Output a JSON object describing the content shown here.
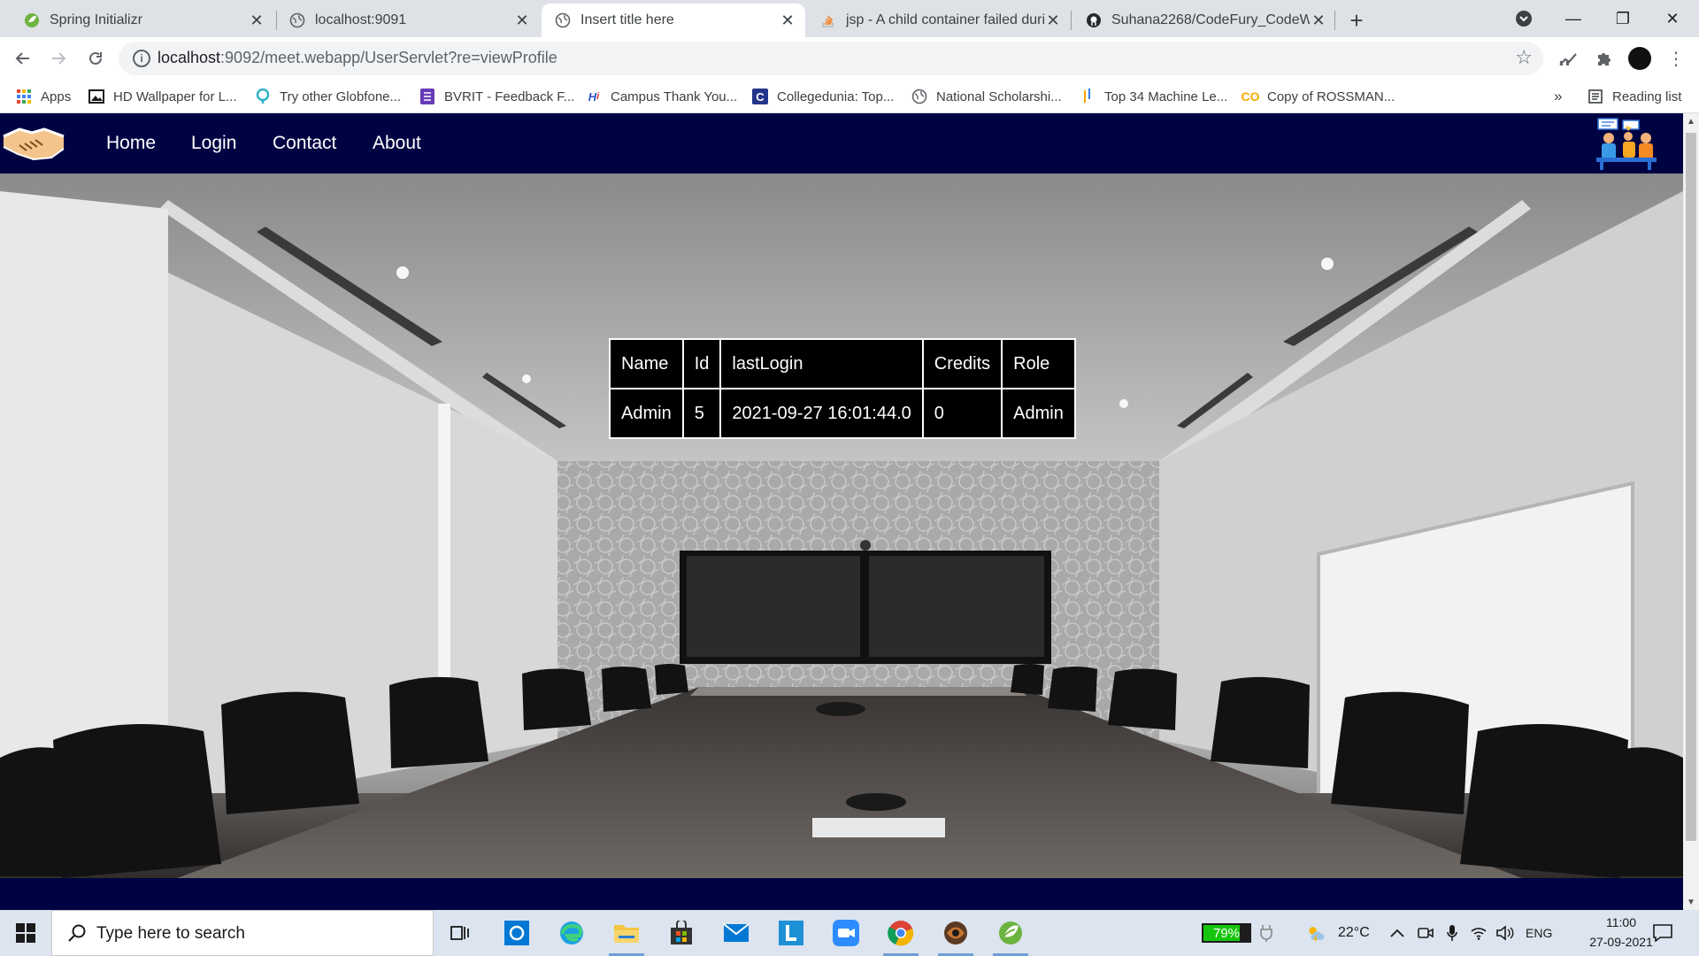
{
  "browser": {
    "tabs": [
      {
        "label": "Spring Initializr",
        "icon": "spring-icon",
        "active": false
      },
      {
        "label": "localhost:9091",
        "icon": "globe-icon",
        "active": false
      },
      {
        "label": "Insert title here",
        "icon": "globe-icon",
        "active": true
      },
      {
        "label": "jsp - A child container failed duri",
        "icon": "stackoverflow-icon",
        "active": false
      },
      {
        "label": "Suhana2268/CodeFury_CodeWar",
        "icon": "github-icon",
        "active": false
      }
    ],
    "new_tab_label": "+",
    "url_host": "localhost",
    "url_path": ":9092/meet.webapp/UserServlet?re=viewProfile",
    "bookmarks": [
      {
        "label": "Apps",
        "icon": "apps-grid-icon"
      },
      {
        "label": "HD Wallpaper for L...",
        "icon": "image-icon"
      },
      {
        "label": "Try other Globfone...",
        "icon": "globfone-icon"
      },
      {
        "label": "BVRIT - Feedback F...",
        "icon": "forms-icon"
      },
      {
        "label": "Campus Thank You...",
        "icon": "hi-icon"
      },
      {
        "label": "Collegedunia: Top...",
        "icon": "collegedunia-icon"
      },
      {
        "label": "National Scholarshi...",
        "icon": "globe-icon"
      },
      {
        "label": "Top 34 Machine Le...",
        "icon": "ml-icon"
      },
      {
        "label": "Copy of ROSSMAN...",
        "icon": "colab-icon"
      }
    ],
    "bookmarks_overflow": "»",
    "reading_list_label": "Reading list"
  },
  "site": {
    "nav": [
      {
        "label": "Home"
      },
      {
        "label": "Login"
      },
      {
        "label": "Contact"
      },
      {
        "label": "About"
      }
    ],
    "colors": {
      "nav_bg": "#000342",
      "table_bg": "#000000",
      "table_text": "#ffffff"
    },
    "profile_table": {
      "headers": [
        "Name",
        "Id",
        "lastLogin",
        "Credits",
        "Role"
      ],
      "rows": [
        [
          "Admin",
          "5",
          "2021-09-27 16:01:44.0",
          "0",
          "Admin"
        ]
      ]
    }
  },
  "taskbar": {
    "search_placeholder": "Type here to search",
    "apps": [
      "task-view-icon",
      "cortana-icon",
      "edge-icon",
      "file-explorer-icon",
      "store-icon",
      "mail-icon",
      "l-app-icon",
      "zoom-icon",
      "chrome-icon",
      "app-icon",
      "spring-tools-icon"
    ],
    "battery_percent": "79%",
    "battery_level": 0.79,
    "temperature": "22°C",
    "language": "ENG",
    "time": "11:00",
    "date": "27-09-2021"
  }
}
